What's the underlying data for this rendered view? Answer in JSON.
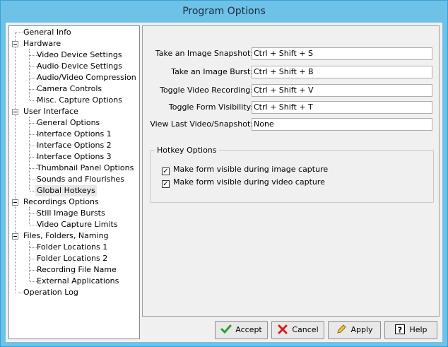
{
  "window": {
    "title": "Program Options"
  },
  "tree": {
    "items": [
      {
        "label": "General Info"
      },
      {
        "label": "Hardware"
      },
      {
        "label": "Video Device Settings"
      },
      {
        "label": "Audio Device Settings"
      },
      {
        "label": "Audio/Video Compression"
      },
      {
        "label": "Camera Controls"
      },
      {
        "label": "Misc. Capture Options"
      },
      {
        "label": "User Interface"
      },
      {
        "label": "General Options"
      },
      {
        "label": "Interface Options 1"
      },
      {
        "label": "Interface Options 2"
      },
      {
        "label": "Interface Options 3"
      },
      {
        "label": "Thumbnail Panel Options"
      },
      {
        "label": "Sounds and Flourishes"
      },
      {
        "label": "Global Hotkeys"
      },
      {
        "label": "Recordings Options"
      },
      {
        "label": "Still Image Bursts"
      },
      {
        "label": "Video Capture Limits"
      },
      {
        "label": "Files, Folders, Naming"
      },
      {
        "label": "Folder Locations 1"
      },
      {
        "label": "Folder Locations 2"
      },
      {
        "label": "Recording File Name"
      },
      {
        "label": "External Applications"
      },
      {
        "label": "Operation Log"
      }
    ]
  },
  "hotkeys": [
    {
      "label": "Take an Image Snapshot:",
      "value": "Ctrl + Shift + S"
    },
    {
      "label": "Take an Image Burst:",
      "value": "Ctrl + Shift + B"
    },
    {
      "label": "Toggle Video Recording:",
      "value": "Ctrl + Shift + V"
    },
    {
      "label": "Toggle Form Visibility:",
      "value": "Ctrl + Shift + T"
    },
    {
      "label": "View Last Video/Snapshot:",
      "value": "None"
    }
  ],
  "hotkey_options": {
    "title": "Hotkey Options",
    "options": [
      {
        "label": "Make form visible during image capture",
        "checked": true
      },
      {
        "label": "Make form visible during video capture",
        "checked": true
      }
    ]
  },
  "buttons": {
    "accept": "Accept",
    "cancel": "Cancel",
    "apply": "Apply",
    "help": "Help"
  }
}
